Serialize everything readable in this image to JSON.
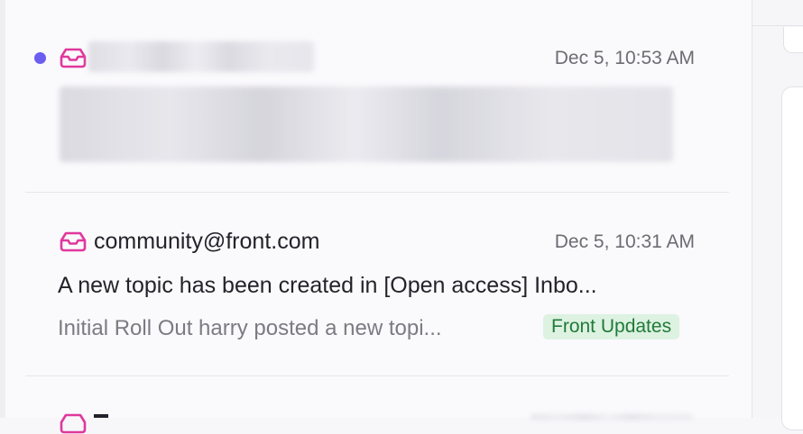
{
  "conversations": [
    {
      "unread": true,
      "sender": "",
      "time": "Dec 5, 10:53 AM",
      "subject": "",
      "preview": "",
      "icon": "inbox-icon",
      "redacted": true
    },
    {
      "unread": false,
      "sender": "community@front.com",
      "time": "Dec 5, 10:31 AM",
      "subject": "A new topic has been created in [Open access] Inbo...",
      "preview": "Initial Roll Out harry posted a new topi...",
      "tag": "Front Updates",
      "icon": "inbox-icon"
    }
  ],
  "colors": {
    "unread_dot": "#6a5df0",
    "inbox_icon": "#e0389c",
    "tag_text": "#217a3a",
    "tag_bg": "#ddf2e1"
  }
}
